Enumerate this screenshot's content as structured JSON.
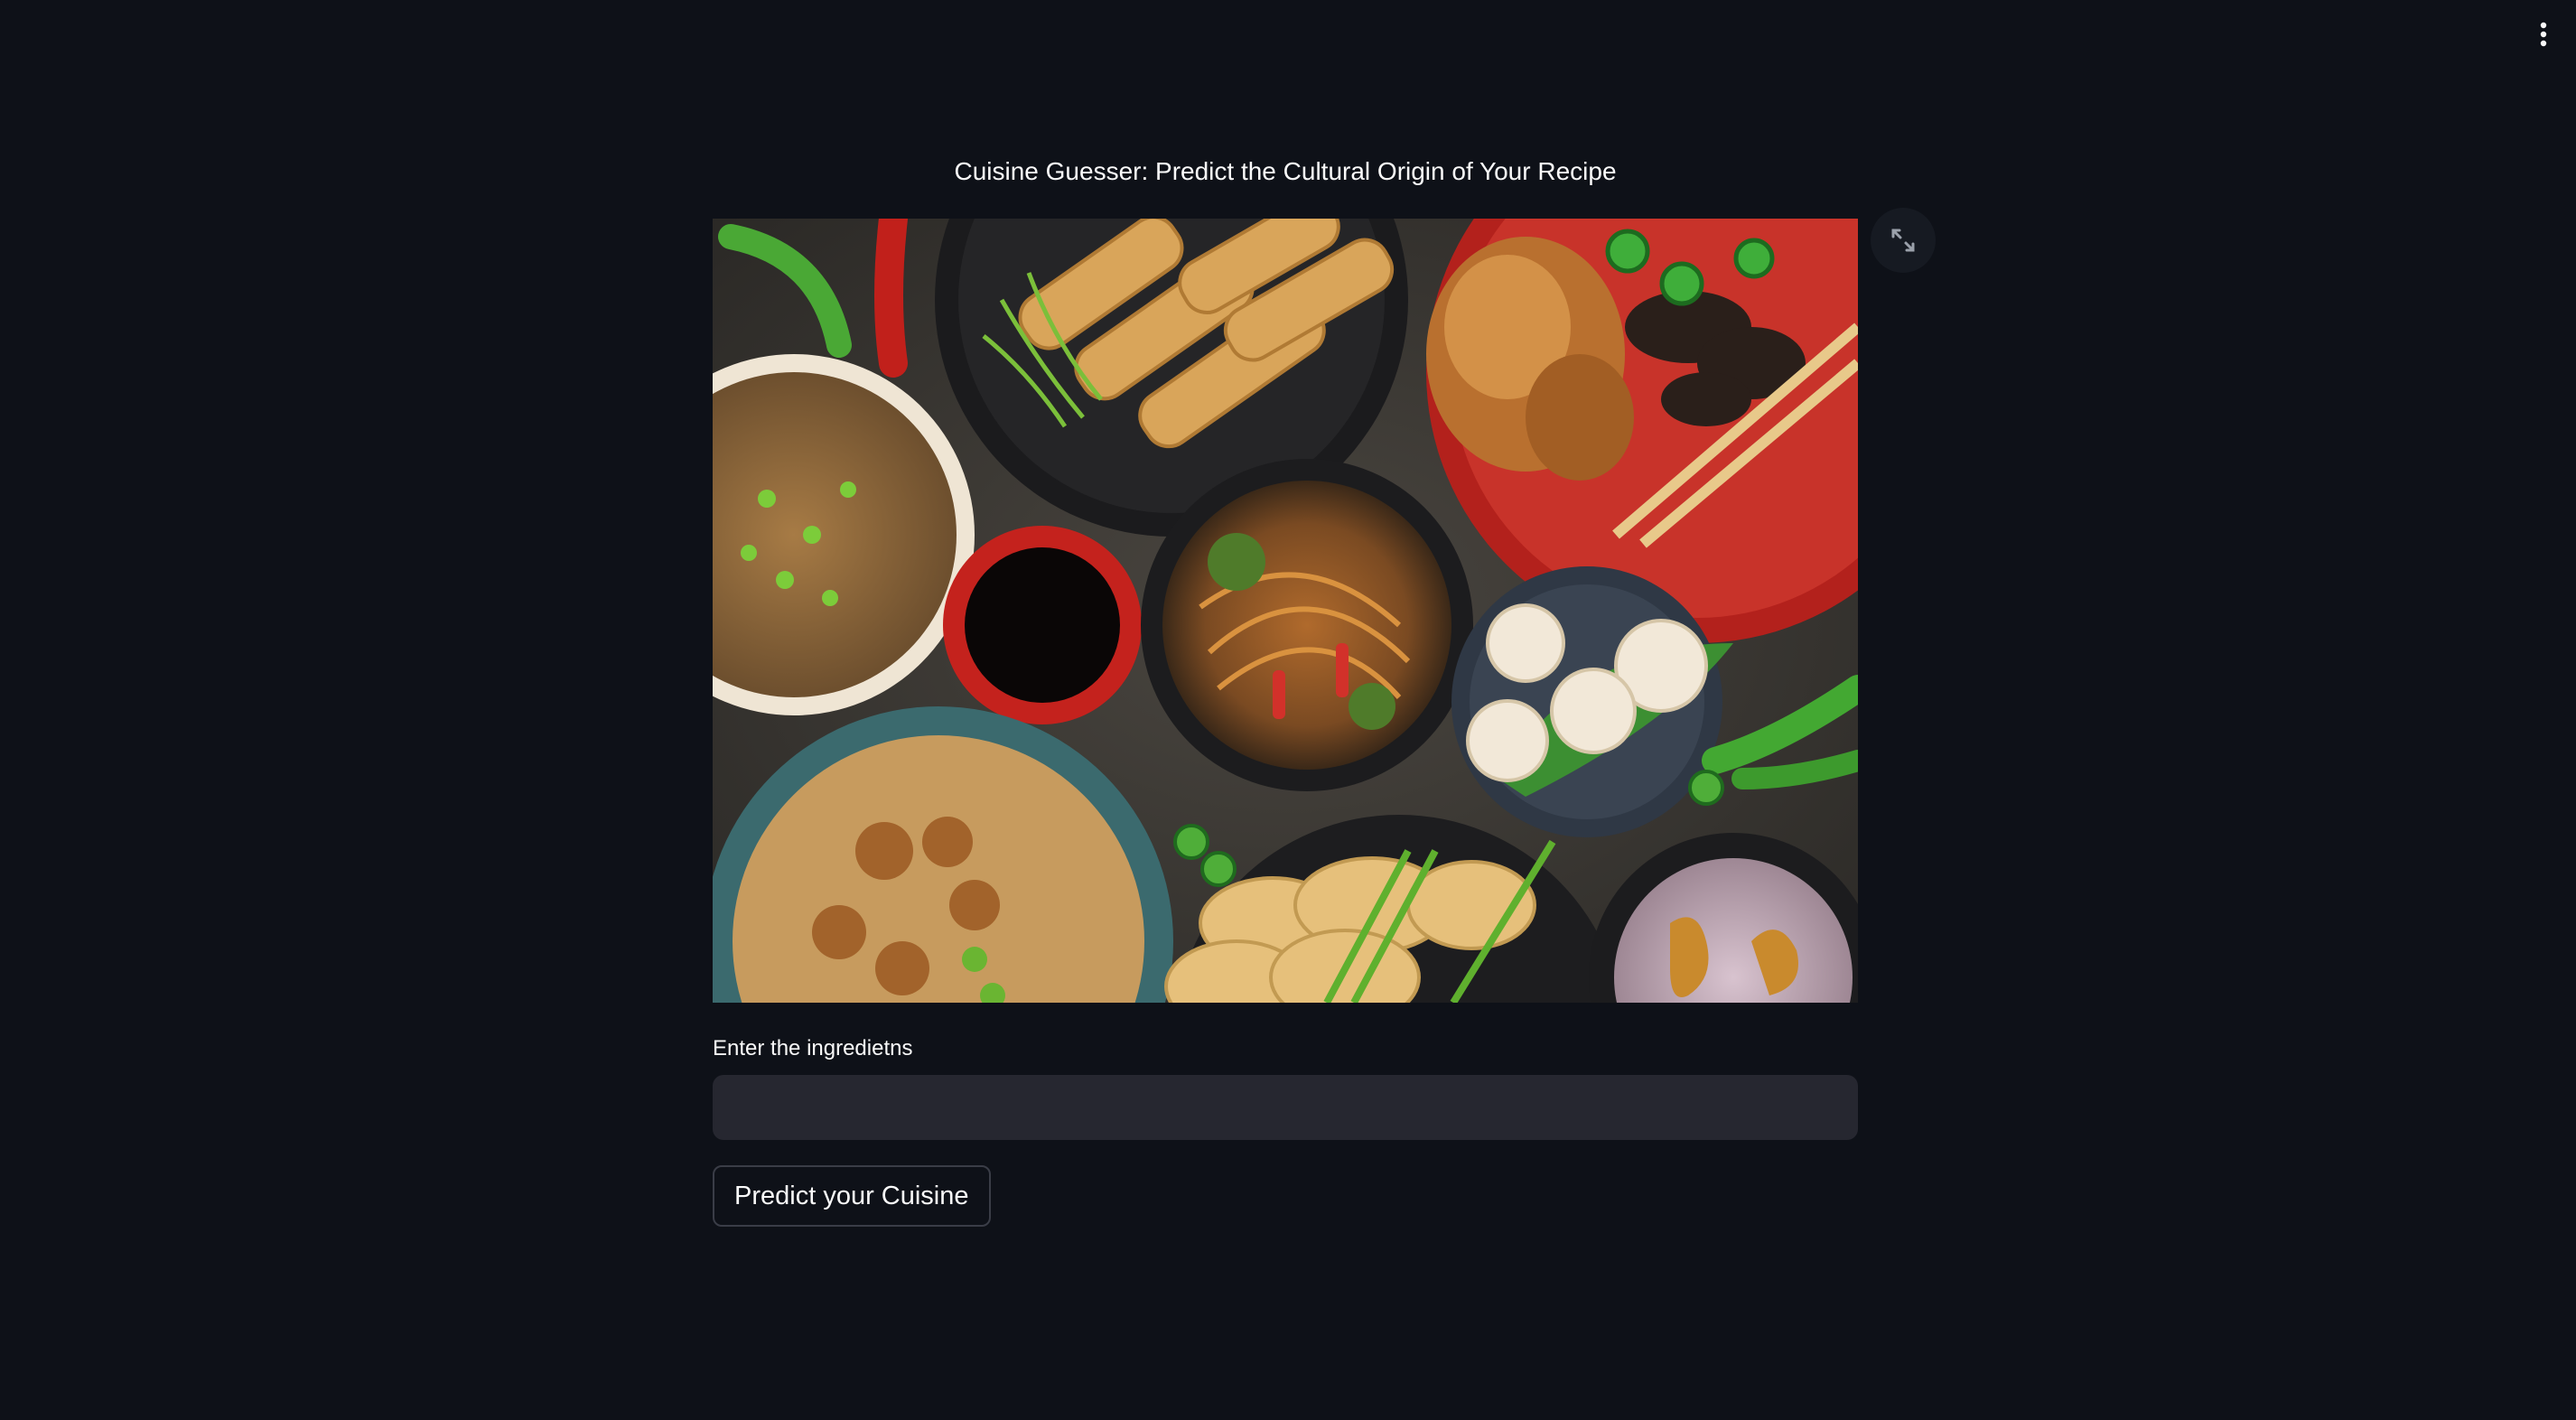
{
  "app": {
    "title": "Cuisine Guesser: Predict the Cultural Origin of Your Recipe"
  },
  "toolbar": {
    "menu_icon": "kebab-menu-icon"
  },
  "image": {
    "alt": "Assorted Asian dishes on a dark wooden table",
    "fullscreen_icon": "expand-icon"
  },
  "form": {
    "ingredients_label": "Enter the ingredietns",
    "ingredients_value": "",
    "predict_button_label": "Predict your Cuisine"
  },
  "colors": {
    "background": "#0e1118",
    "input_background": "#262730",
    "button_border": "#3a3d47",
    "text": "#fafafa"
  }
}
